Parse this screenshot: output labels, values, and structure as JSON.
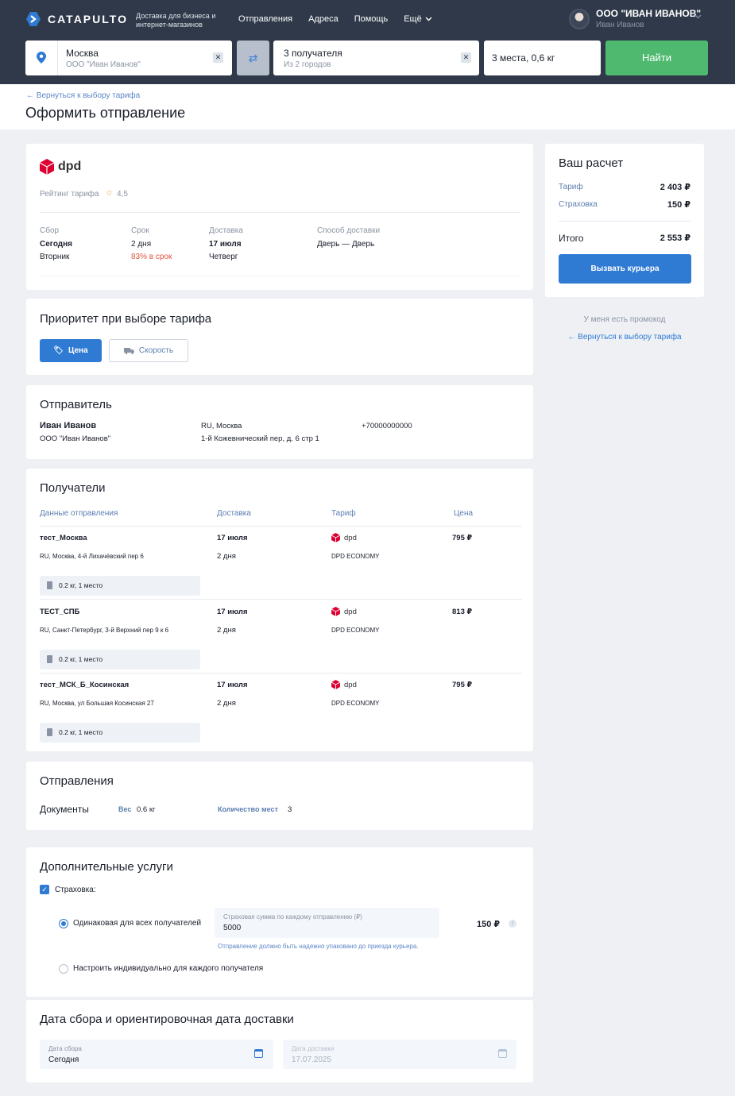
{
  "header": {
    "logo": "CATAPULTO",
    "tagline": "Доставка для бизнеса и интернет-магазинов",
    "nav": [
      "Отправления",
      "Адреса",
      "Помощь",
      "Ещё"
    ],
    "user_company": "ООО \"ИВАН ИВАНОВ\"",
    "user_name": "Иван Иванов"
  },
  "search": {
    "from_city": "Москва",
    "from_company": "ООО \"Иван Иванов\"",
    "to_main": "3 получателя",
    "to_sub": "Из 2 городов",
    "cargo": "3 места, 0,6 кг",
    "find_label": "Найти"
  },
  "page": {
    "back_link": "Вернуться к выбору тарифа",
    "title": "Оформить отправление"
  },
  "tariff": {
    "carrier": "dpd",
    "rating_label": "Рейтинг тарифа",
    "rating": "4,5",
    "pickup_label": "Сбор",
    "pickup_value": "Сегодня",
    "pickup_day": "Вторник",
    "term_label": "Срок",
    "term_value": "2 дня",
    "term_ontime": "83% в срок",
    "delivery_label": "Доставка",
    "delivery_value": "17 июля",
    "delivery_day": "Четверг",
    "method_label": "Способ доставки",
    "method_value": "Дверь — Дверь"
  },
  "priority": {
    "title": "Приоритет при выборе тарифа",
    "price_label": "Цена",
    "speed_label": "Скорость"
  },
  "sender": {
    "title": "Отправитель",
    "name": "Иван Иванов",
    "company": "ООО \"Иван Иванов\"",
    "city": "RU, Москва",
    "address": "1-й Кожевнический пер, д. 6 стр 1",
    "phone": "+70000000000"
  },
  "recipients": {
    "title": "Получатели",
    "columns": [
      "Данные отправления",
      "Доставка",
      "Тариф",
      "Цена"
    ],
    "rows": [
      {
        "name": "тест_Москва",
        "address": "RU, Москва, 4-й Лихачёвский пер 6",
        "package": "0.2 кг, 1 место",
        "delivery": "17 июля",
        "term": "2 дня",
        "carrier": "dpd",
        "tariff": "DPD ECONOMY",
        "price": "795 ₽"
      },
      {
        "name": "ТЕСТ_СПБ",
        "address": "RU, Санкт-Петербург, 3-й Верхний пер 9 к 6",
        "package": "0.2 кг, 1 место",
        "delivery": "17 июля",
        "term": "2 дня",
        "carrier": "dpd",
        "tariff": "DPD ECONOMY",
        "price": "813 ₽"
      },
      {
        "name": "тест_МСК_Б_Косинская",
        "address": "RU, Москва, ул Большая Косинская 27",
        "package": "0.2 кг, 1 место",
        "delivery": "17 июля",
        "term": "2 дня",
        "carrier": "dpd",
        "tariff": "DPD ECONOMY",
        "price": "795 ₽"
      }
    ]
  },
  "shipments": {
    "title": "Отправления",
    "type": "Документы",
    "weight_label": "Вес",
    "weight": "0.6 кг",
    "places_label": "Количество мест",
    "places": "3"
  },
  "services": {
    "title": "Дополнительные услуги",
    "insurance_label": "Страховка:",
    "same_label": "Одинаковая для всех получателей",
    "sum_label": "Страховая сумма по каждому отправлению (₽)",
    "sum_value": "5000",
    "note": "Отправление должно быть надежно упаковано до приезда курьера.",
    "insurance_price": "150 ₽",
    "individual_label": "Настроить индивидуально для каждого получателя"
  },
  "dates": {
    "title": "Дата сбора и ориентировочная дата доставки",
    "pickup_label": "Дата сбора",
    "pickup_value": "Сегодня",
    "delivery_label": "Дата доставки",
    "delivery_value": "17.07.2025"
  },
  "calc": {
    "title": "Ваш расчет",
    "tariff_label": "Тариф",
    "tariff_value": "2 403 ₽",
    "insurance_label": "Страховка",
    "insurance_value": "150 ₽",
    "total_label": "Итого",
    "total_value": "2 553 ₽",
    "courier_label": "Вызвать курьера",
    "promo": "У меня есть промокод",
    "back_link": "Вернуться к выбору тарифа"
  },
  "colors": {
    "header_bg": "#2f3949",
    "accent": "#2f7bd3",
    "find_button": "#4fba6f",
    "dpd_red": "#dc0032",
    "warn": "#e5533d"
  }
}
